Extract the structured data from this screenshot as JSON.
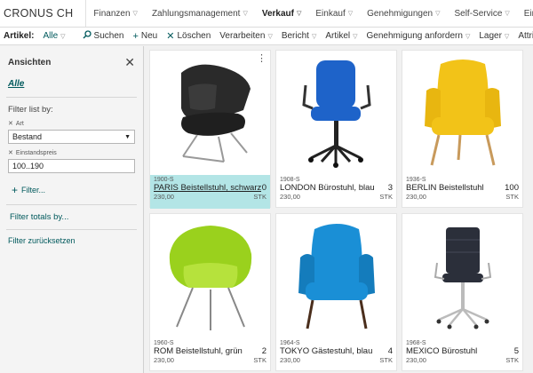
{
  "topnav": {
    "company": "CRONUS CH",
    "items": [
      {
        "label": "Finanzen"
      },
      {
        "label": "Zahlungsmanagement"
      },
      {
        "label": "Verkauf"
      },
      {
        "label": "Einkauf"
      },
      {
        "label": "Genehmigungen"
      },
      {
        "label": "Self-Service"
      },
      {
        "label": "Einrichtung und Erweiterungen"
      }
    ]
  },
  "actionbar": {
    "title": "Artikel:",
    "filter": "Alle",
    "buttons": [
      {
        "label": "Suchen",
        "icon": "search-icon"
      },
      {
        "label": "Neu",
        "icon": "plus-icon"
      },
      {
        "label": "Löschen",
        "icon": "delete-icon"
      },
      {
        "label": "Verarbeiten"
      },
      {
        "label": "Bericht"
      },
      {
        "label": "Artikel"
      },
      {
        "label": "Genehmigung anfordern"
      },
      {
        "label": "Lager"
      },
      {
        "label": "Attribute"
      }
    ]
  },
  "sidebar": {
    "title": "Ansichten",
    "all_view": "Alle",
    "filter_list_by": "Filter list by:",
    "filter1_label": "Art",
    "filter1_value": "Bestand",
    "filter2_label": "Einstandspreis",
    "filter2_value": "100..190",
    "add_filter": "Filter...",
    "filter_totals": "Filter totals by...",
    "reset": "Filter zurücksetzen"
  },
  "items": [
    {
      "code": "1900-S",
      "name": "PARIS Beistellstuhl, schwarz",
      "qty": "0",
      "price": "230,00",
      "unit": "STK",
      "color": "#2a2a2a",
      "selected": true
    },
    {
      "code": "1908-S",
      "name": "LONDON Bürostuhl, blau",
      "qty": "3",
      "price": "230,00",
      "unit": "STK",
      "color": "#1e63c9",
      "selected": false
    },
    {
      "code": "1936-S",
      "name": "BERLIN Beistellstuhl",
      "qty": "100",
      "price": "230,00",
      "unit": "STK",
      "color": "#f2c318",
      "selected": false
    },
    {
      "code": "1960-S",
      "name": "ROM Beistellstuhl, grün",
      "qty": "2",
      "price": "230,00",
      "unit": "STK",
      "color": "#9ad11d",
      "selected": false
    },
    {
      "code": "1964-S",
      "name": "TOKYO Gästestuhl, blau",
      "qty": "4",
      "price": "230,00",
      "unit": "STK",
      "color": "#1a8fd6",
      "selected": false
    },
    {
      "code": "1968-S",
      "name": "MEXICO Bürostuhl",
      "qty": "5",
      "price": "230,00",
      "unit": "STK",
      "color": "#2b2f3a",
      "selected": false
    }
  ]
}
